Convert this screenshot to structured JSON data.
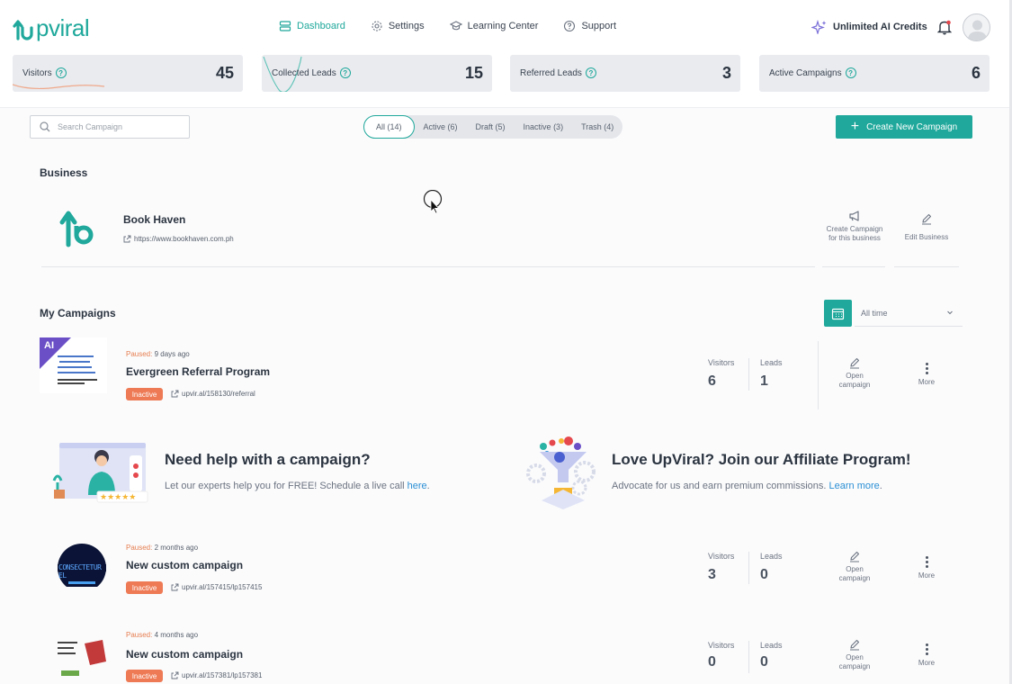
{
  "app": {
    "logo_text": "pviral",
    "brand_color": "#1fa89b"
  },
  "nav": [
    {
      "label": "Dashboard",
      "icon": "dashboard-icon",
      "active": true
    },
    {
      "label": "Settings",
      "icon": "gear-icon",
      "active": false
    },
    {
      "label": "Learning Center",
      "icon": "graduation-cap-icon",
      "active": false
    },
    {
      "label": "Support",
      "icon": "help-circle-icon",
      "active": false
    }
  ],
  "header": {
    "credits_label": "Unlimited AI Credits"
  },
  "stats": [
    {
      "label": "Visitors",
      "value": "45"
    },
    {
      "label": "Collected Leads",
      "value": "15"
    },
    {
      "label": "Referred Leads",
      "value": "3"
    },
    {
      "label": "Active Campaigns",
      "value": "6"
    }
  ],
  "toolbar": {
    "search_placeholder": "Search Campaign",
    "filters": [
      "All (14)",
      "Active (6)",
      "Draft (5)",
      "Inactive (3)",
      "Trash (4)"
    ],
    "active_filter": "All (14)",
    "create_label": "Create New Campaign"
  },
  "business": {
    "section_title": "Business",
    "name": "Book Haven",
    "url": "https://www.bookhaven.com.ph",
    "create_campaign_label_1": "Create Campaign",
    "create_campaign_label_2": "for this business",
    "edit_label": "Edit Business"
  },
  "campaigns_section": {
    "title": "My Campaigns",
    "date_filter": "All time"
  },
  "campaigns": [
    {
      "status_word": "Paused:",
      "status_time": "9 days ago",
      "title": "Evergreen Referral Program",
      "badge": "Inactive",
      "link": "upvir.al/158130/referral",
      "visitors_label": "Visitors",
      "visitors": "6",
      "leads_label": "Leads",
      "leads": "1",
      "open_1": "Open",
      "open_2": "campaign",
      "more": "More",
      "ai_tag": "AI"
    },
    {
      "status_word": "Paused:",
      "status_time": "2 months ago",
      "title": "New custom campaign",
      "badge": "Inactive",
      "link": "upvir.al/157415/lp157415",
      "visitors_label": "Visitors",
      "visitors": "3",
      "leads_label": "Leads",
      "leads": "0",
      "open_1": "Open",
      "open_2": "campaign",
      "more": "More",
      "thumb_text": "CONSECTETUR EL"
    },
    {
      "status_word": "Paused:",
      "status_time": "4 months ago",
      "title": "New custom campaign",
      "badge": "Inactive",
      "link": "upvir.al/157381/lp157381",
      "visitors_label": "Visitors",
      "visitors": "0",
      "leads_label": "Leads",
      "leads": "0",
      "open_1": "Open",
      "open_2": "campaign",
      "more": "More"
    }
  ],
  "promos": {
    "help": {
      "title": "Need help with a campaign?",
      "text": "Let our experts help you for FREE! Schedule a live call ",
      "link": "here",
      "after": "."
    },
    "affiliate": {
      "title": "Love UpViral? Join our Affiliate Program!",
      "text": "Advocate for us and earn premium commissions. ",
      "link": "Learn more",
      "after": "."
    }
  }
}
